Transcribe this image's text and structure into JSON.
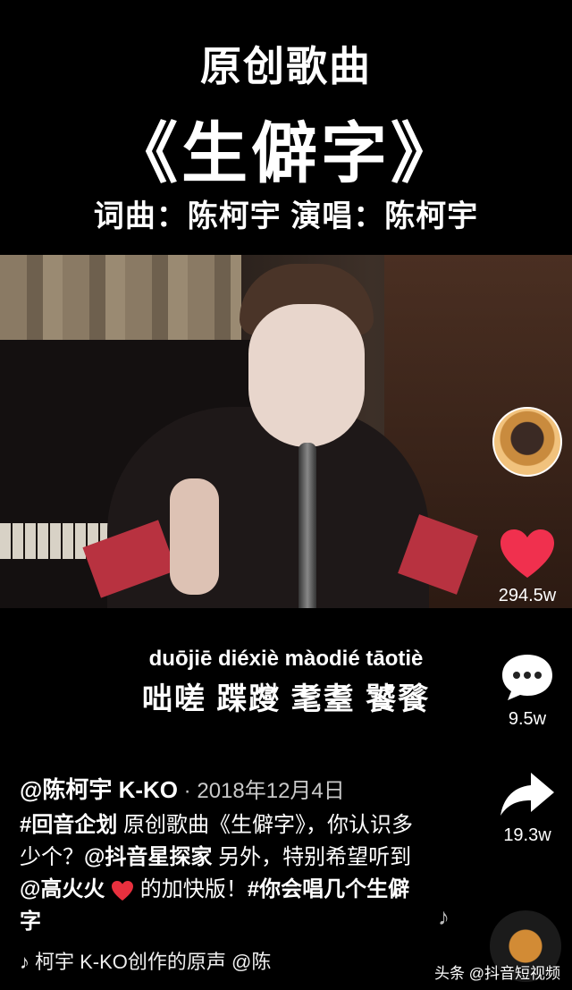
{
  "header": {
    "line1": "原创歌曲",
    "line2": "《生僻字》",
    "line3": "词曲：陈柯宇 演唱：陈柯宇"
  },
  "subtitle": {
    "pinyin": "duōjiē diéxiè màodié tāotiè",
    "chars": "咄嗟 蹀躞 耄耋 饕餮"
  },
  "post": {
    "author": "@陈柯宇 K-KO",
    "date": " · 2018年12月4日",
    "caption_parts": {
      "tag1": "#回音企划",
      "text1": " 原创歌曲《生僻字》，你认识多少个？",
      "mention1": "@抖音星探家",
      "text2": " 另外，特别希望听到",
      "mention2": "@高火火",
      "text3": " 的加快版！",
      "tag2": "#你会唱几个生僻字"
    },
    "music": "柯宇 K-KO创作的原声    @陈"
  },
  "actions": {
    "likes": "294.5w",
    "comments": "9.5w",
    "shares": "19.3w"
  },
  "watermark": "头条 @抖音短视频",
  "colors": {
    "like": "#f0304e",
    "background": "#000000"
  },
  "icons": [
    "heart-icon",
    "comment-icon",
    "share-icon",
    "music-note-icon",
    "music-disc-icon"
  ]
}
